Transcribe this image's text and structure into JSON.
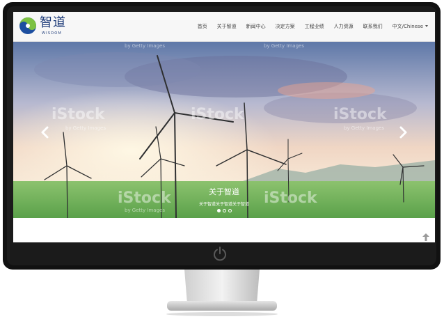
{
  "brand": {
    "name": "智道",
    "tagline": "WISDOM"
  },
  "nav": {
    "items": [
      "首页",
      "关于智道",
      "新闻中心",
      "决定方案",
      "工程业绩",
      "人力资源",
      "联系我们"
    ],
    "language": "中文/Chinese"
  },
  "slider": {
    "title": "关于智道",
    "text": "关于智道关于智道关于智道",
    "slides": 3,
    "active_index": 0,
    "watermark_brand": "iStock",
    "watermark_credit": "by Getty Images"
  },
  "icons": {
    "prev": "chevron-left-icon",
    "next": "chevron-right-icon",
    "up": "arrow-up-icon",
    "power": "power-icon"
  }
}
